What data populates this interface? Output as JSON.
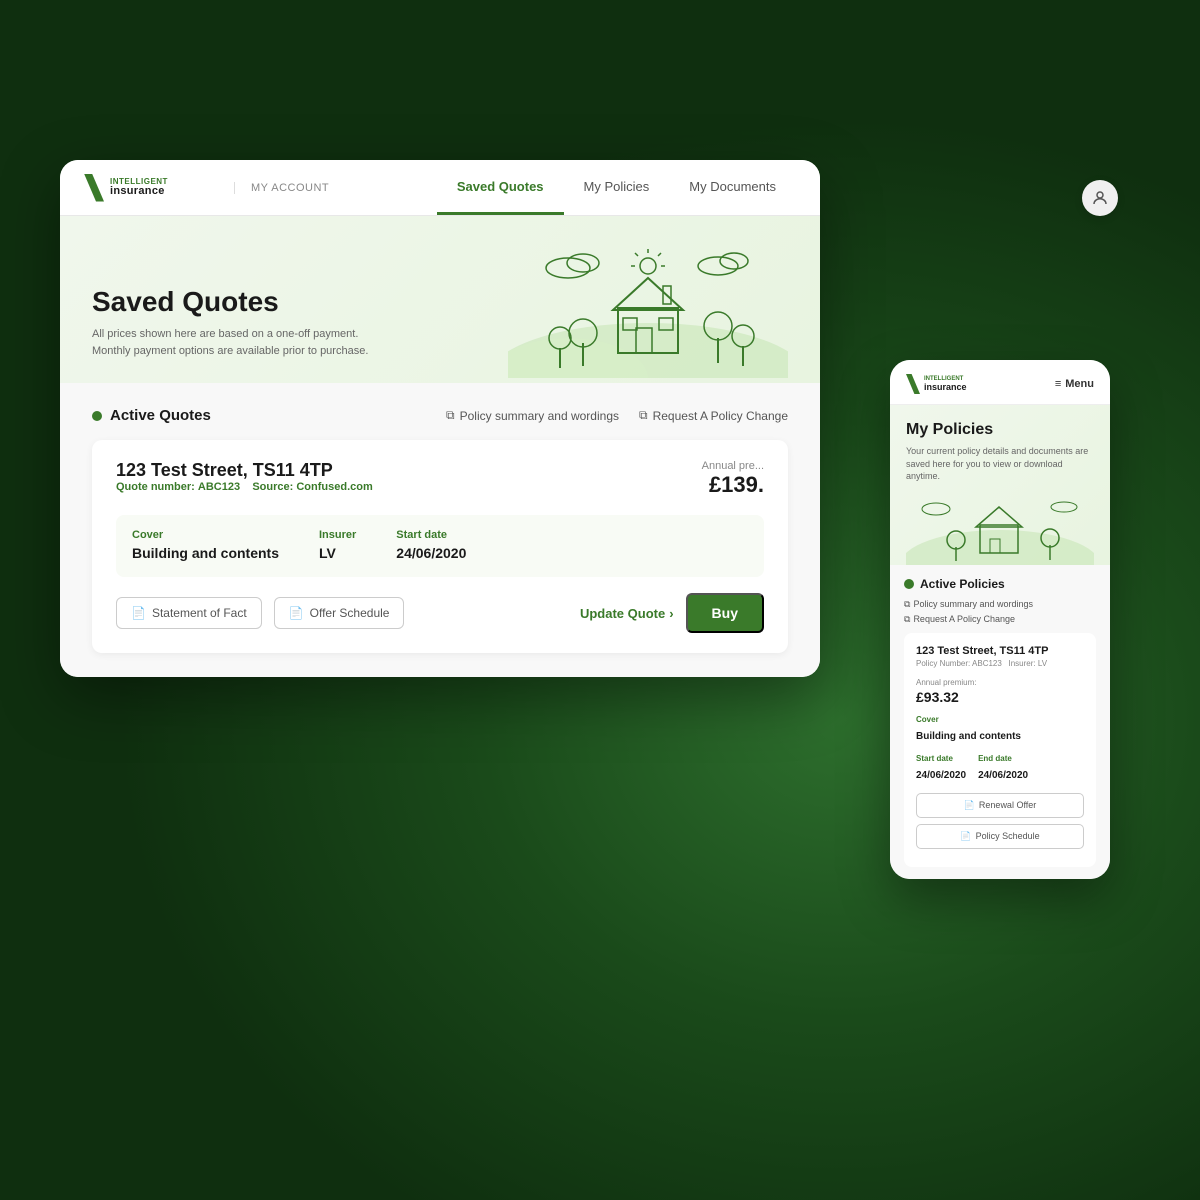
{
  "brand": {
    "intelligent": "INTELLIGENT",
    "insurance": "insurance"
  },
  "desktop": {
    "my_account_label": "MY ACCOUNT",
    "nav_tabs": [
      {
        "id": "saved-quotes",
        "label": "Saved Quotes",
        "active": true
      },
      {
        "id": "my-policies",
        "label": "My Policies",
        "active": false
      },
      {
        "id": "my-documents",
        "label": "My Documents",
        "active": false
      }
    ],
    "hero": {
      "title": "Saved Quotes",
      "subtitle": "All prices shown here are based on a one-off payment. Monthly payment options are available prior to purchase."
    },
    "active_quotes": {
      "section_label": "Active Quotes",
      "action1": "Policy summary and wordings",
      "action2": "Request A Policy Change",
      "card": {
        "address": "123 Test Street, TS11 4TP",
        "quote_number_label": "Quote number:",
        "quote_number": "ABC123",
        "source_label": "Source:",
        "source": "Confused.com",
        "annual_price_label": "Annual pre...",
        "annual_price": "£139.",
        "cover_label": "Cover",
        "cover_value": "Building and contents",
        "insurer_label": "Insurer",
        "insurer_value": "LV",
        "start_date_label": "Start date",
        "start_date_value": "24/06/2020",
        "btn_statement": "Statement of Fact",
        "btn_offer": "Offer Schedule",
        "btn_update": "Update Quote",
        "btn_buy": "Buy"
      }
    }
  },
  "mobile": {
    "menu_label": "Menu",
    "hero": {
      "title": "My Policies",
      "subtitle": "Your current policy details and documents are saved here for you to view or download anytime."
    },
    "active_policies": {
      "section_label": "Active Policies",
      "action1": "Policy summary and wordings",
      "action2": "Request A Policy Change",
      "card": {
        "address": "123 Test Street, TS11 4TP",
        "policy_number_label": "Policy Number:",
        "policy_number": "ABC123",
        "insurer_label": "Insurer:",
        "insurer": "LV",
        "annual_premium_label": "Annual premium:",
        "annual_premium": "£93.32",
        "cover_label": "Cover",
        "cover_value": "Building and contents",
        "start_date_label": "Start date",
        "start_date_value": "24/06/2020",
        "end_date_label": "End date",
        "end_date_value": "24/06/2020",
        "btn_renewal": "Renewal Offer",
        "btn_policy_schedule": "Policy Schedule"
      }
    }
  },
  "icons": {
    "user": "👤",
    "document": "📄",
    "external_link": "⧉",
    "chevron_right": "›",
    "hamburger": "≡"
  },
  "colors": {
    "green_primary": "#3a7a2a",
    "green_light": "#f0f7ec",
    "white": "#ffffff",
    "dark_bg": "#1a4a1a"
  }
}
